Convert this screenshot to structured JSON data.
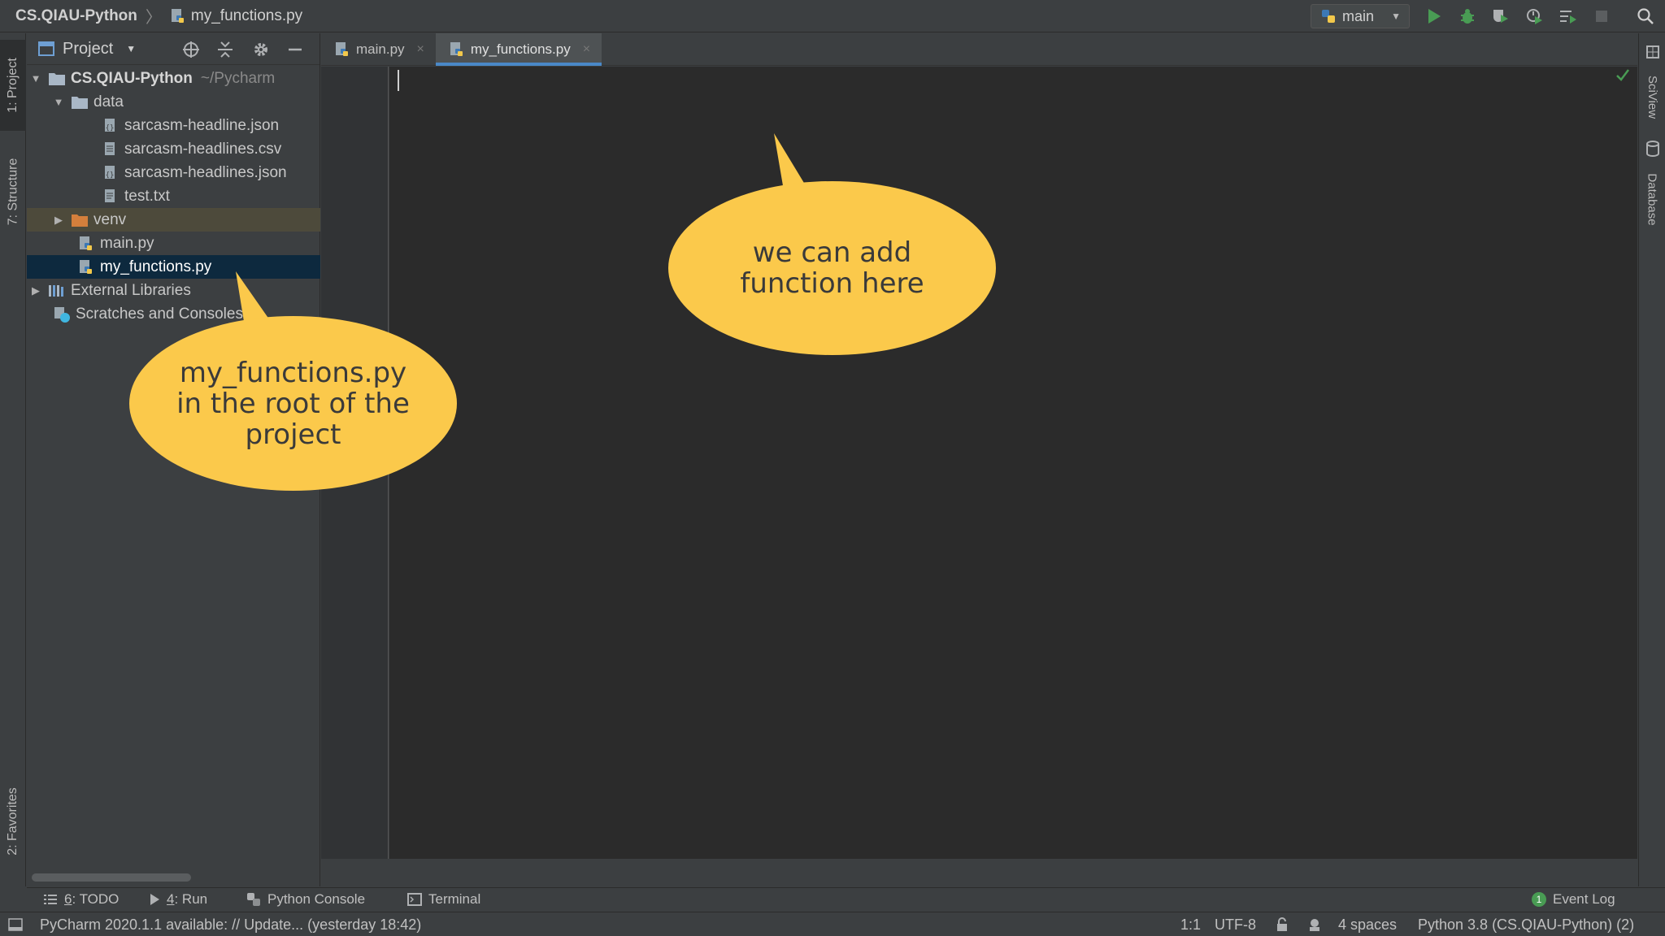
{
  "navbar": {
    "project": "CS.QIAU-Python",
    "separator": "〉",
    "file": "my_functions.py",
    "run_config": "main"
  },
  "left_stripe": {
    "project_tab": "1: Project",
    "structure_tab": "7: Structure",
    "favorites_tab": "2: Favorites"
  },
  "project_panel": {
    "title": "Project",
    "tree": {
      "root": {
        "label": "CS.QIAU-Python",
        "path": "~/Pycharm"
      },
      "data": "data",
      "files": [
        "sarcasm-headline.json",
        "sarcasm-headlines.csv",
        "sarcasm-headlines.json",
        "test.txt"
      ],
      "venv": "venv",
      "main": "main.py",
      "my_functions": "my_functions.py",
      "external": "External Libraries",
      "scratches": "Scratches and Consoles"
    }
  },
  "editor": {
    "tabs": [
      {
        "label": "main.py",
        "active": false
      },
      {
        "label": "my_functions.py",
        "active": true
      }
    ],
    "close_glyph": "×"
  },
  "right_stripe": {
    "sciview": "SciView",
    "database": "Database"
  },
  "toolwindows": {
    "todo_num": "6",
    "todo": ": TODO",
    "run_num": "4",
    "run": ": Run",
    "console": "Python Console",
    "terminal": "Terminal",
    "event_log": "Event Log",
    "event_count": "1"
  },
  "statusbar": {
    "message": "PyCharm 2020.1.1 available: // Update... (yesterday 18:42)",
    "position": "1:1",
    "encoding": "UTF-8",
    "indent": "4 spaces",
    "interpreter": "Python 3.8 (CS.QIAU-Python) (2)"
  },
  "callouts": {
    "editor_note_1": "we can add",
    "editor_note_2": "function here",
    "tree_note_1": "my_functions.py",
    "tree_note_2": "in the root of the",
    "tree_note_3": "project"
  },
  "colors": {
    "accent": "#4a88c7",
    "callout": "#fbc94b",
    "selection": "#0d293e",
    "run_green": "#499c54"
  }
}
